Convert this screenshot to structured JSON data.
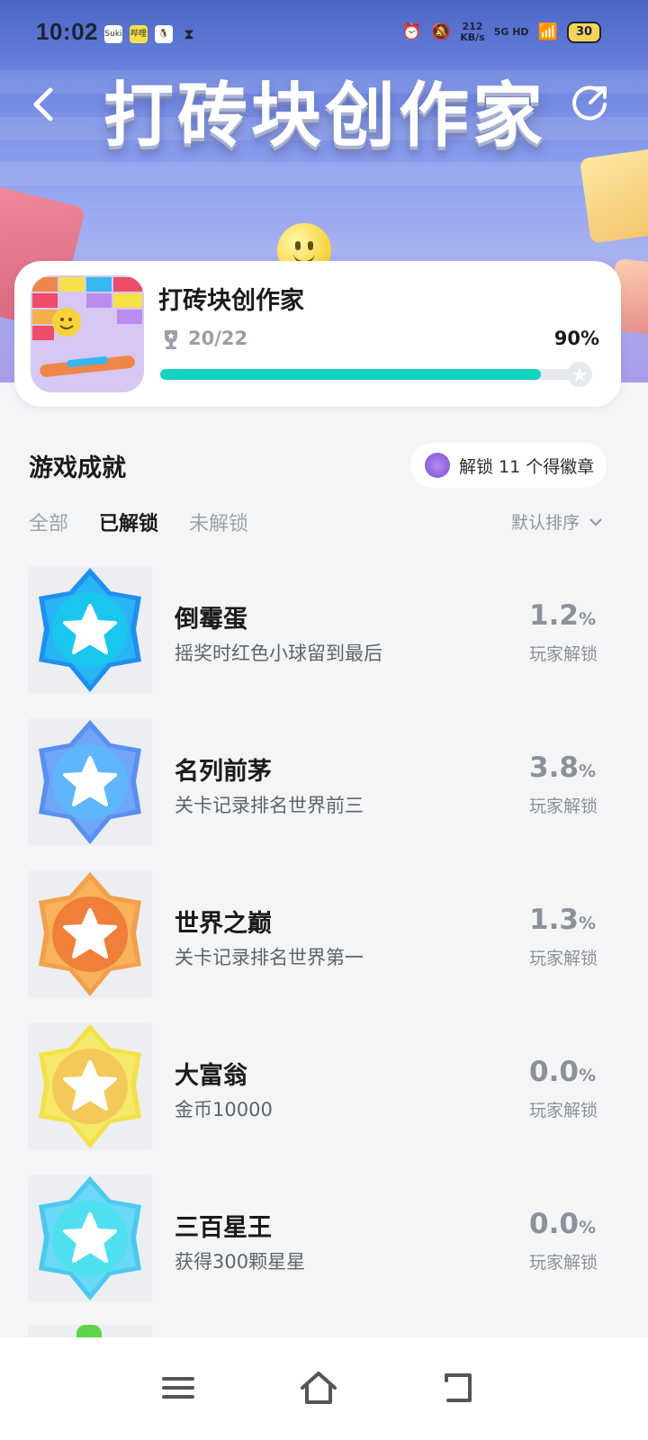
{
  "status_bar": {
    "time": "10:02",
    "app_icons": [
      "Suki",
      "哔哩",
      "qq",
      "hourglass"
    ],
    "net_speed_value": "212",
    "net_speed_unit": "KB/s",
    "network": "5G HD",
    "battery": "30"
  },
  "header": {
    "title": "打砖块创作家",
    "back_icon": "chevron-left-icon",
    "share_icon": "share-icon"
  },
  "game_card": {
    "name": "打砖块创作家",
    "progress_count": "20/22",
    "progress_percent_label": "90%",
    "progress_fraction": 0.9
  },
  "achievements": {
    "title": "游戏成就",
    "unlock_hint": "解锁 11 个得徽章",
    "tabs": [
      {
        "label": "全部",
        "active": false
      },
      {
        "label": "已解锁",
        "active": true
      },
      {
        "label": "未解锁",
        "active": false
      }
    ],
    "sort_label": "默认排序",
    "rate_label": "玩家解锁",
    "items": [
      {
        "name": "倒霉蛋",
        "desc": "摇奖时红色小球留到最后",
        "rate": "1.2",
        "unit": "%",
        "color_outer": "#1e8ff0",
        "color_mid": "#2ab3f5",
        "color_inner": "#19c6ee"
      },
      {
        "name": "名列前茅",
        "desc": "关卡记录排名世界前三",
        "rate": "3.8",
        "unit": "%",
        "color_outer": "#5a8ff2",
        "color_mid": "#6fa6f7",
        "color_inner": "#5fb6fb"
      },
      {
        "name": "世界之巅",
        "desc": "关卡记录排名世界第一",
        "rate": "1.3",
        "unit": "%",
        "color_outer": "#f3a04a",
        "color_mid": "#f7b25b",
        "color_inner": "#f07f3a"
      },
      {
        "name": "大富翁",
        "desc": "金币10000",
        "rate": "0.0",
        "unit": "%",
        "color_outer": "#f2e24a",
        "color_mid": "#f6e96a",
        "color_inner": "#f4c95a"
      },
      {
        "name": "三百星王",
        "desc": "获得300颗星星",
        "rate": "0.0",
        "unit": "%",
        "color_outer": "#4cc9f0",
        "color_mid": "#6ad8f6",
        "color_inner": "#4fe0f0"
      }
    ]
  },
  "nav_bar": {
    "menu_icon": "menu-icon",
    "home_icon": "home-icon",
    "back_icon": "back-icon"
  }
}
